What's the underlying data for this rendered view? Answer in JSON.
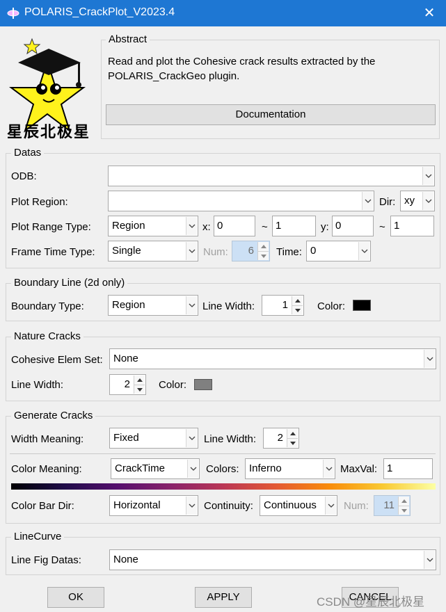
{
  "window": {
    "title": "POLARIS_CrackPlot_V2023.4",
    "close_symbol": "✕"
  },
  "abstract": {
    "heading": "Abstract",
    "text_line1": "Read and plot the Cohesive crack results extracted by the",
    "text_line2": "POLARIS_CrackGeo plugin.",
    "documentation_button": "Documentation",
    "logo_text": "星辰北极星"
  },
  "datas": {
    "heading": "Datas",
    "odb_label": "ODB:",
    "odb_value": "",
    "plot_region_label": "Plot Region:",
    "plot_region_value": "",
    "dir_label": "Dir:",
    "dir_value": "xy",
    "plot_range_type_label": "Plot Range Type:",
    "plot_range_type_value": "Region",
    "x_label": "x:",
    "x_from": "0",
    "tilde1": "~",
    "x_to": "1",
    "y_label": "y:",
    "y_from": "0",
    "tilde2": "~",
    "y_to": "1",
    "frame_time_type_label": "Frame Time Type:",
    "frame_time_type_value": "Single",
    "num_label": "Num:",
    "num_value": "6",
    "time_label": "Time:",
    "time_value": "0"
  },
  "boundary": {
    "heading": "Boundary Line (2d only)",
    "type_label": "Boundary Type:",
    "type_value": "Region",
    "line_width_label": "Line Width:",
    "line_width_value": "1",
    "color_label": "Color:",
    "color": "#000000"
  },
  "nature": {
    "heading": "Nature Cracks",
    "elem_set_label": "Cohesive Elem Set:",
    "elem_set_value": "None",
    "line_width_label": "Line Width:",
    "line_width_value": "2",
    "color_label": "Color:",
    "color": "#808080"
  },
  "generate": {
    "heading": "Generate Cracks",
    "width_meaning_label": "Width Meaning:",
    "width_meaning_value": "Fixed",
    "line_width_label": "Line Width:",
    "line_width_value": "2",
    "color_meaning_label": "Color Meaning:",
    "color_meaning_value": "CrackTime",
    "colors_label": "Colors:",
    "colors_value": "Inferno",
    "maxval_label": "MaxVal:",
    "maxval_value": "1",
    "colorbar_dir_label": "Color Bar Dir:",
    "colorbar_dir_value": "Horizontal",
    "continuity_label": "Continuity:",
    "continuity_value": "Continuous",
    "num_label": "Num:",
    "num_value": "11"
  },
  "linecurve": {
    "heading": "LineCurve",
    "fig_datas_label": "Line Fig Datas:",
    "fig_datas_value": "None"
  },
  "footer": {
    "ok": "OK",
    "apply": "APPLY",
    "cancel": "CANCEL",
    "watermark": "CSDN @星辰北极星"
  }
}
